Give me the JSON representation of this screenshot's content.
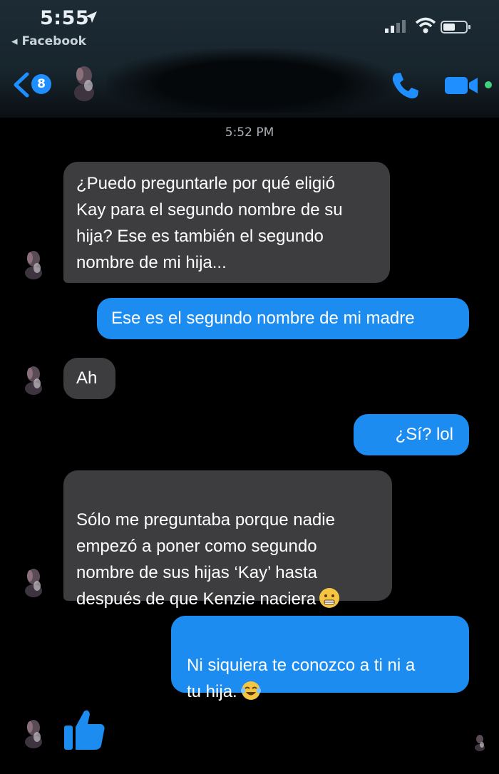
{
  "status_bar": {
    "time": "5:55",
    "back_app": "◂ Facebook"
  },
  "nav": {
    "unread_count": "8"
  },
  "conversation": {
    "timestamp": "5:52 PM",
    "messages": [
      {
        "from": "them",
        "text": "¿Puedo preguntarle por qué eligió\nKay para el segundo nombre de su\nhija? Ese es también el segundo\nnombre de mi hija..."
      },
      {
        "from": "me",
        "text": "Ese es el segundo nombre de mi madre"
      },
      {
        "from": "them",
        "text": "Ah"
      },
      {
        "from": "me",
        "text": "¿Sí? lol"
      },
      {
        "from": "them",
        "text": "Sólo me preguntaba porque nadie\nempezó a poner como segundo\nnombre de sus hijas ‘Kay’ hasta\ndespués de que Kenzie naciera",
        "emoji": "grimace-emoji-icon"
      },
      {
        "from": "me",
        "text": "Ni siquiera te conozco a ti ni a\ntu hija.",
        "emoji": "laughing-tears-emoji-icon"
      },
      {
        "from": "me",
        "text": "",
        "type": "like"
      }
    ]
  },
  "colors": {
    "outgoing": "#1d8cf0",
    "incoming": "#3d3d3f",
    "accent": "#1f8fff",
    "active": "#3fd37b"
  }
}
